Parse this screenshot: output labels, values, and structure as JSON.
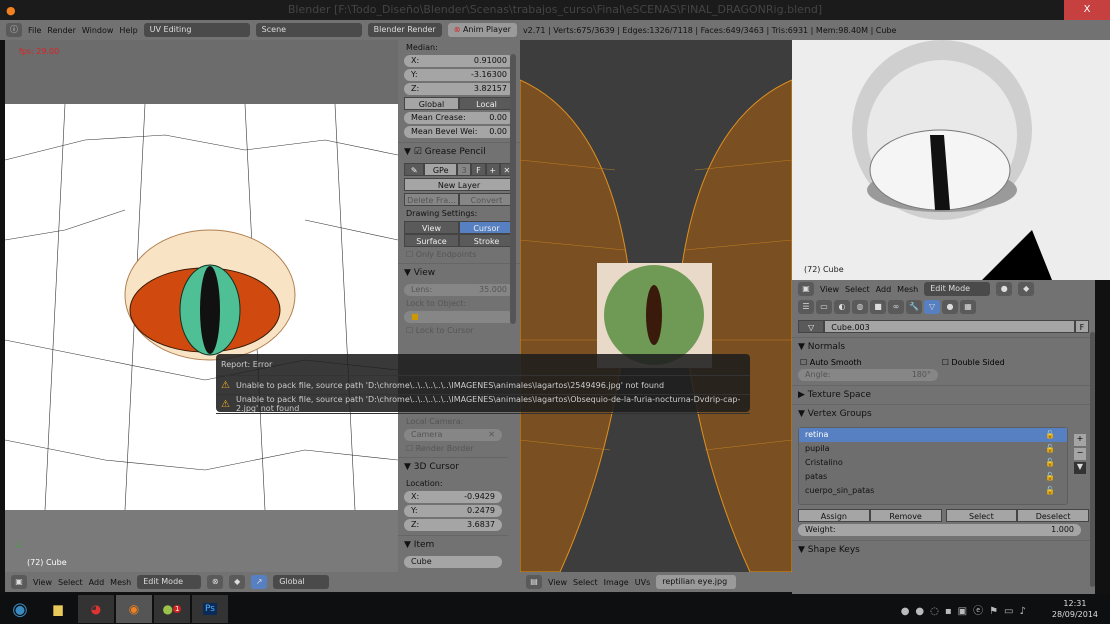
{
  "window": {
    "title": "Blender [F:\\Todo_Diseño\\Blender\\Scenas\\trabajos_curso\\Final\\eSCENAS\\FINAL_DRAGONRig.blend]",
    "close": "X"
  },
  "info_header": {
    "menus": [
      "File",
      "Render",
      "Window",
      "Help"
    ],
    "screen": "UV Editing",
    "scene": "Scene",
    "engine": "Blender Render",
    "anim_player": "Anim Player",
    "stats": "v2.71 | Verts:675/3639 | Edges:1326/7118 | Faces:649/3463 | Tris:6931 | Mem:98.40M | Cube"
  },
  "viewport3d": {
    "fps": "fps: 29.00",
    "object_label": "(72) Cube",
    "header": {
      "menus": [
        "View",
        "Select",
        "Add",
        "Mesh"
      ],
      "mode": "Edit Mode",
      "orientation": "Global"
    }
  },
  "npanel": {
    "median_label": "Median:",
    "median": [
      {
        "k": "X:",
        "v": "0.91000"
      },
      {
        "k": "Y:",
        "v": "-3.16300"
      },
      {
        "k": "Z:",
        "v": "3.82157"
      }
    ],
    "global": "Global",
    "local": "Local",
    "mean_crease": {
      "k": "Mean Crease:",
      "v": "0.00"
    },
    "mean_bevel": {
      "k": "Mean Bevel Wei:",
      "v": "0.00"
    },
    "grease_pencil": "Grease Pencil",
    "gp_layer": "GPe",
    "gp_users": "3",
    "gp_f": "F",
    "new_layer": "New Layer",
    "delete_frame": "Delete Fra...",
    "convert": "Convert",
    "drawing_settings": "Drawing Settings:",
    "view": "View",
    "cursor": "Cursor",
    "surface": "Surface",
    "stroke": "Stroke",
    "only_endpoints": "Only Endpoints",
    "view_section": "View",
    "lens": {
      "k": "Lens:",
      "v": "35.000"
    },
    "lock_to_object": "Lock to Object:",
    "lock_to_cursor": "Lock to Cursor",
    "local_camera": "Local Camera:",
    "camera": "Camera",
    "render_border": "Render Border",
    "cursor_section": "3D Cursor",
    "location": "Location:",
    "cursor_loc": [
      {
        "k": "X:",
        "v": "-0.9429"
      },
      {
        "k": "Y:",
        "v": "0.2479"
      },
      {
        "k": "Z:",
        "v": "3.6837"
      }
    ],
    "item_section": "Item",
    "item_name": "Cube"
  },
  "error_report": {
    "title": "Report: Error",
    "messages": [
      "Unable to pack file, source path 'D:\\chrome\\..\\..\\..\\..\\..\\IMAGENES\\animales\\lagartos\\2549496.jpg' not found",
      "Unable to pack file, source path 'D:\\chrome\\..\\..\\..\\..\\..\\IMAGENES\\animales\\lagartos\\Obsequio-de-la-furia-nocturna-Dvdrip-cap-2.jpg' not found"
    ]
  },
  "uv_editor": {
    "header": {
      "menus": [
        "View",
        "Select",
        "Image",
        "UVs"
      ],
      "image": "reptilian eye.jpg"
    }
  },
  "render_view": {
    "object_label": "(72) Cube"
  },
  "properties": {
    "header": {
      "menus": [
        "View",
        "Select",
        "Add",
        "Mesh"
      ],
      "mode": "Edit Mode"
    },
    "mesh_name": "Cube.003",
    "fake_user": "F",
    "normals": "Normals",
    "auto_smooth": "Auto Smooth",
    "double_sided": "Double Sided",
    "angle": {
      "k": "Angle:",
      "v": "180°"
    },
    "texture_space": "Texture Space",
    "vertex_groups": "Vertex Groups",
    "groups": [
      "retina",
      "pupila",
      "Cristalino",
      "patas",
      "cuerpo_sin_patas"
    ],
    "assign": "Assign",
    "remove": "Remove",
    "select": "Select",
    "deselect": "Deselect",
    "weight": {
      "k": "Weight:",
      "v": "1.000"
    },
    "shape_keys": "Shape Keys"
  },
  "taskbar": {
    "time": "12:31",
    "date": "28/09/2014",
    "spotify_badge": "1",
    "ps": "Ps"
  },
  "colors": {
    "accent": "#5680c2",
    "error": "#c74040",
    "panel": "#727272"
  }
}
